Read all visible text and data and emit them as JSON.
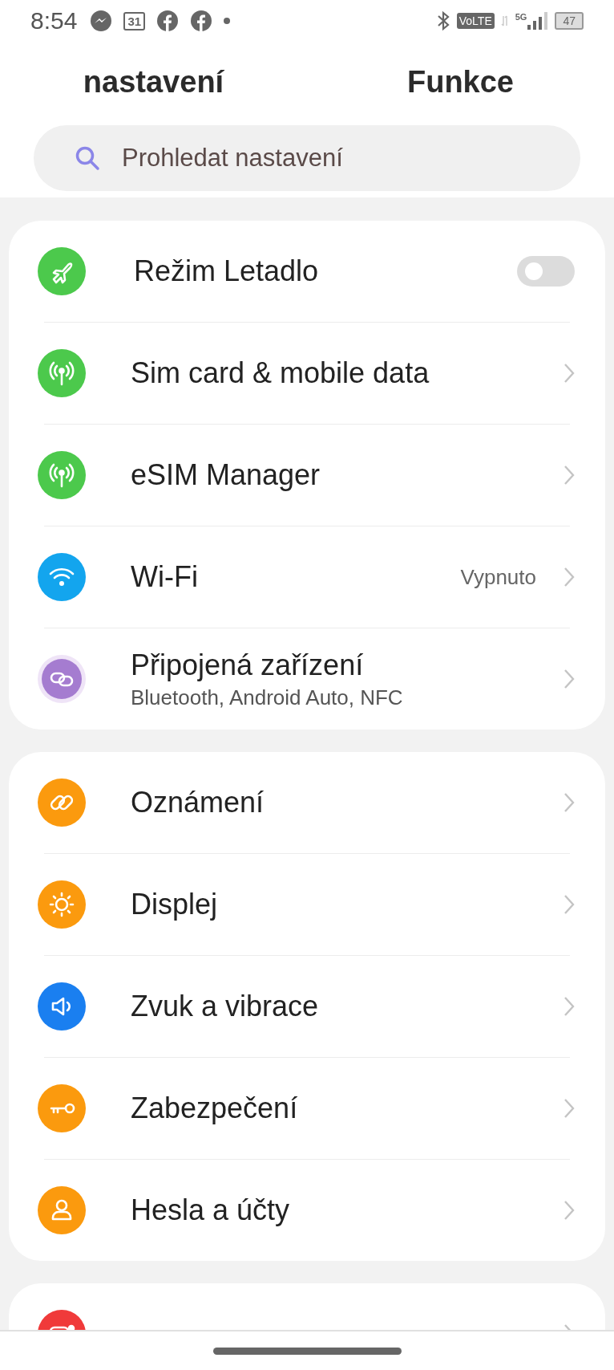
{
  "status_bar": {
    "time": "8:54",
    "calendar_day": "31",
    "volte": "VoLTE",
    "network": "5G",
    "battery": "47"
  },
  "tabs": [
    {
      "label": "nastavení"
    },
    {
      "label": "Funkce"
    }
  ],
  "search": {
    "placeholder": "Prohledat nastavení"
  },
  "groups": [
    {
      "items": [
        {
          "kind": "toggle",
          "title": "Režim Letadlo",
          "on": false,
          "color": "#4cc94c"
        },
        {
          "kind": "link",
          "title": "Sim card & mobile data",
          "color": "#4cc94c"
        },
        {
          "kind": "link",
          "title": "eSIM Manager",
          "color": "#4cc94c"
        },
        {
          "kind": "link",
          "title": "Wi-Fi",
          "value": "Vypnuto",
          "color": "#13a5ee"
        },
        {
          "kind": "link",
          "title": "Připojená zařízení",
          "subtitle": "Bluetooth, Android Auto, NFC",
          "color": "#a57cd0"
        }
      ]
    },
    {
      "items": [
        {
          "kind": "link",
          "title": "Oznámení",
          "color": "#fb9a0e"
        },
        {
          "kind": "link",
          "title": "Displej",
          "color": "#fb9a0e"
        },
        {
          "kind": "link",
          "title": "Zvuk a vibrace",
          "color": "#1a7ff0"
        },
        {
          "kind": "link",
          "title": "Zabezpečení",
          "color": "#fb9a0e"
        },
        {
          "kind": "link",
          "title": "Hesla a účty",
          "color": "#fb9a0e"
        }
      ]
    },
    {
      "items": [
        {
          "kind": "link",
          "color": "#f03a3a"
        }
      ]
    }
  ]
}
